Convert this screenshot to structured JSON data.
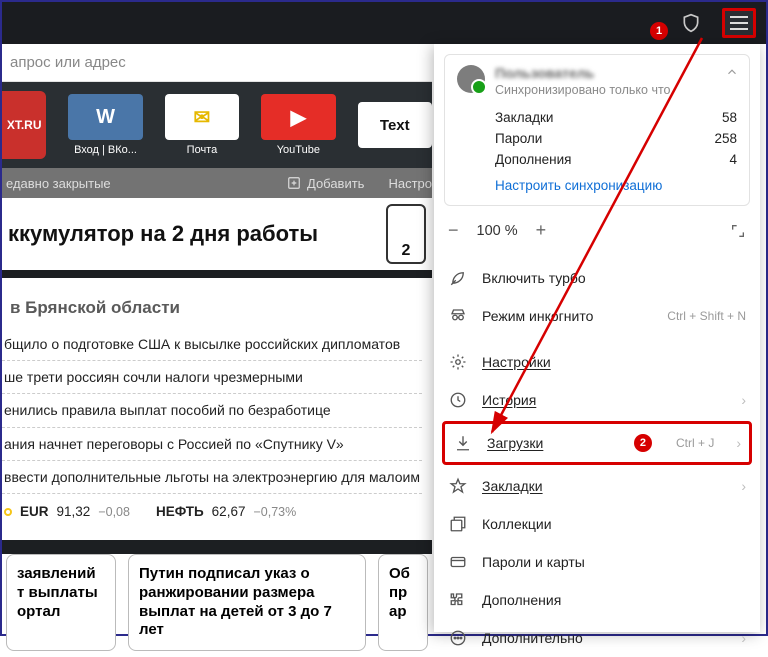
{
  "badges": {
    "one": "1",
    "two": "2"
  },
  "address_bar": {
    "placeholder": "апрос или адрес"
  },
  "speeddial": {
    "tiles": [
      {
        "big_text": "XT.RU",
        "label": "",
        "bg": "#c43a36"
      },
      {
        "big_text": "W",
        "label": "Вход | ВКо...",
        "bg": "#4a76a8"
      },
      {
        "big_text": "✉",
        "label": "Почта",
        "bg": "#ffffff"
      },
      {
        "big_text": "▶",
        "label": "YouTube",
        "bg": "#e52d27"
      }
    ],
    "extra_label": "Text",
    "recently_closed": "едавно закрытые",
    "add": "Добавить",
    "settings": "Настро"
  },
  "banner": {
    "title": "ккумулятор на 2 дня работы",
    "phonemark": "2"
  },
  "news": {
    "region": "в Брянской области",
    "items": [
      "бщило о подготовке США к высылке российских дипломатов",
      "ше трети россиян сочли налоги чрезмерными",
      "енились правила выплат пособий по безработице",
      "ания начнет переговоры с Россией по «Спутнику V»",
      "ввести дополнительные льготы на электроэнергию для малоим"
    ],
    "rates": {
      "eur_label": "EUR",
      "eur_val": "91,32",
      "eur_delta": "−0,08",
      "oil_label": "НЕФТЬ",
      "oil_val": "62,67",
      "oil_delta": "−0,73%"
    }
  },
  "cards": [
    "заявлений\nт выплаты\nортал",
    "Путин подписал указ о\nранжировании размера\nвыплат на детей от 3 до 7\nлет",
    "Об\nпр\nар"
  ],
  "sync": {
    "username": "Пользователь",
    "status": "Синхронизировано только что",
    "rows": [
      {
        "label": "Закладки",
        "value": "58"
      },
      {
        "label": "Пароли",
        "value": "258"
      },
      {
        "label": "Дополнения",
        "value": "4"
      }
    ],
    "configure": "Настроить синхронизацию"
  },
  "zoom": {
    "minus": "−",
    "value": "100 %",
    "plus": "+"
  },
  "menu": {
    "turbo": "Включить турбо",
    "incognito": "Режим инкогнито",
    "incognito_sc": "Ctrl + Shift + N",
    "settings": "Настройки",
    "history": "История",
    "downloads": "Загрузки",
    "downloads_sc": "Ctrl + J",
    "bookmarks": "Закладки",
    "collections": "Коллекции",
    "passwords": "Пароли и карты",
    "addons": "Дополнения",
    "more": "Дополнительно"
  }
}
